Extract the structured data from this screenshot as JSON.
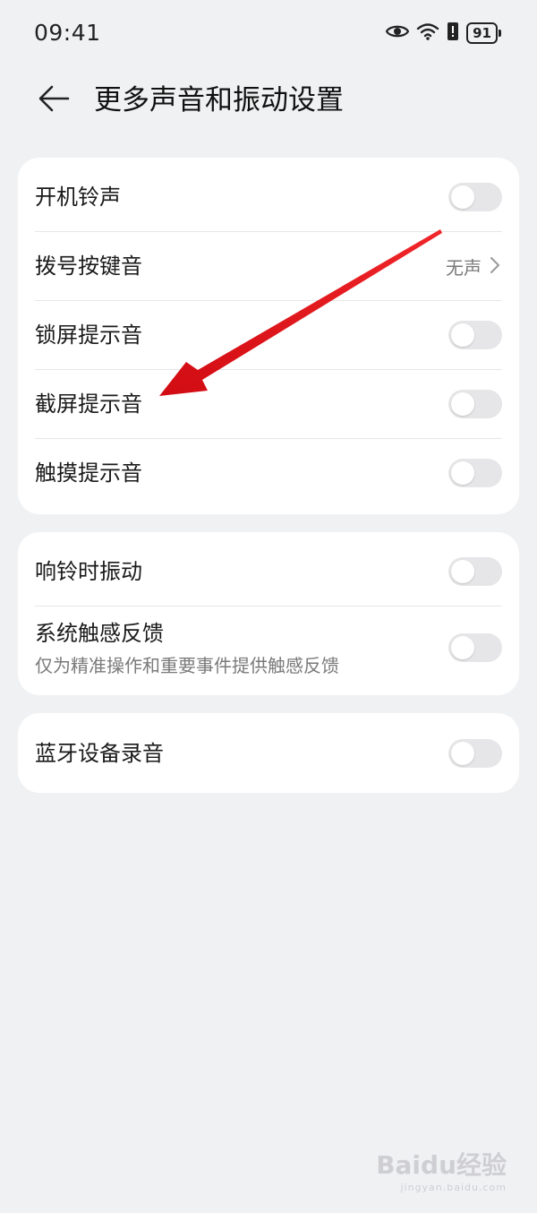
{
  "status_bar": {
    "time": "09:41",
    "battery_level": "91",
    "icons": [
      "eye-icon",
      "wifi-icon",
      "alert-icon",
      "battery-icon"
    ]
  },
  "header": {
    "back_icon": "arrow-left-icon",
    "title": "更多声音和振动设置"
  },
  "groups": [
    {
      "items": [
        {
          "label": "开机铃声",
          "control": "toggle",
          "on": false
        },
        {
          "label": "拨号按键音",
          "control": "value",
          "value": "无声"
        },
        {
          "label": "锁屏提示音",
          "control": "toggle",
          "on": false
        },
        {
          "label": "截屏提示音",
          "control": "toggle",
          "on": false
        },
        {
          "label": "触摸提示音",
          "control": "toggle",
          "on": false
        }
      ]
    },
    {
      "items": [
        {
          "label": "响铃时振动",
          "control": "toggle",
          "on": false
        },
        {
          "label": "系统触感反馈",
          "sublabel": "仅为精准操作和重要事件提供触感反馈",
          "control": "toggle",
          "on": false
        }
      ]
    },
    {
      "items": [
        {
          "label": "蓝牙设备录音",
          "control": "toggle",
          "on": false
        }
      ]
    }
  ],
  "annotation": {
    "color": "#e8141a",
    "target": "截屏提示音"
  },
  "watermark": {
    "logo": "Baidu经验",
    "url": "jingyan.baidu.com"
  },
  "colors": {
    "background": "#f0f1f3",
    "card": "#ffffff",
    "toggle_off": "#e6e6e8",
    "secondary_text": "#7a7a7a"
  }
}
